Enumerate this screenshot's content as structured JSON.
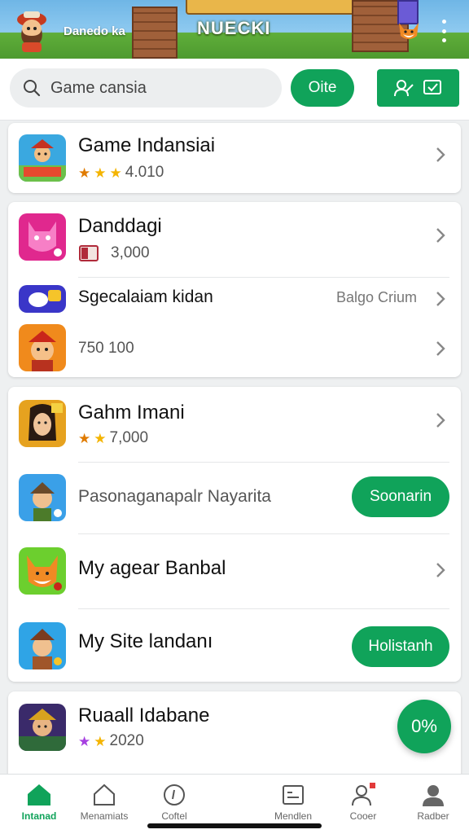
{
  "header": {
    "username": "Danedo  ka",
    "title": "NUECKI"
  },
  "search": {
    "value": "Game cansia",
    "button_label": "Oite"
  },
  "cards": [
    {
      "rows": [
        {
          "title": "Game  Indansiai",
          "rating_value": "4.010",
          "stars": 3
        }
      ]
    },
    {
      "rows": [
        {
          "title": "Danddagi",
          "meta": "3,000"
        },
        {
          "title": "Sgecalaiam  kidan",
          "side_label": "Balgo Crium"
        },
        {
          "meta": "750 100"
        }
      ]
    },
    {
      "rows": [
        {
          "title": "Gahm Imani",
          "rating_value": "7,000",
          "stars": 2
        },
        {
          "title": "Pasonaganapalr  Nayarita",
          "button_label": "Soonarin"
        },
        {
          "title": "My  agear  Banbal"
        },
        {
          "title": "My Site landanı",
          "button_label": "Holistanh"
        }
      ]
    },
    {
      "rows": [
        {
          "title": "Ruaall  Idabane",
          "rating_value": "2020",
          "stars": 2
        }
      ]
    }
  ],
  "fab": {
    "label": "0%"
  },
  "bottom_nav": [
    {
      "label": "Intanad",
      "icon": "home-icon",
      "active": true
    },
    {
      "label": "Menamiats",
      "icon": "house-outline-icon",
      "active": false
    },
    {
      "label": "Coftel",
      "icon": "circle-icon",
      "active": false
    },
    {
      "label": "Mendlen",
      "icon": "window-icon",
      "active": false
    },
    {
      "label": "Cooer",
      "icon": "profile-icon",
      "active": false
    },
    {
      "label": "Radber",
      "icon": "person-icon",
      "active": false
    }
  ],
  "colors": {
    "accent": "#10a35a",
    "star_gold": "#f4b400",
    "star_orange": "#e07b00",
    "star_purple": "#a640e0"
  }
}
